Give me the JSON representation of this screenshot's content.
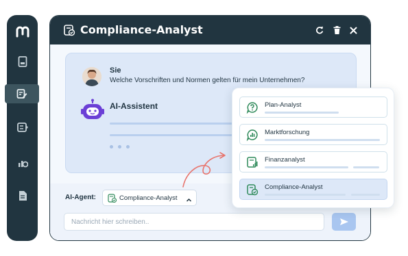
{
  "window": {
    "title": "Compliance-Analyst"
  },
  "chat": {
    "user_name": "Sie",
    "user_message": "Welche Vorschriften und Normen gelten für mein Unternehmen?",
    "bot_name": "AI-Assistent"
  },
  "composer": {
    "agent_label": "AI-Agent:",
    "selected_agent": "Compliance-Analyst",
    "placeholder": "Nachricht hier schreiben.."
  },
  "agent_options": [
    {
      "label": "Plan-Analyst",
      "icon": "plan-question-icon"
    },
    {
      "label": "Marktforschung",
      "icon": "market-research-icon"
    },
    {
      "label": "Finanzanalyst",
      "icon": "finance-chart-icon"
    },
    {
      "label": "Compliance-Analyst",
      "icon": "compliance-check-icon",
      "selected": true
    }
  ],
  "colors": {
    "navy": "#213540",
    "accent_green": "#2f8a5a",
    "highlight": "#dde8f8",
    "arrow": "#e8746c",
    "bot": "#6b3fd6"
  }
}
